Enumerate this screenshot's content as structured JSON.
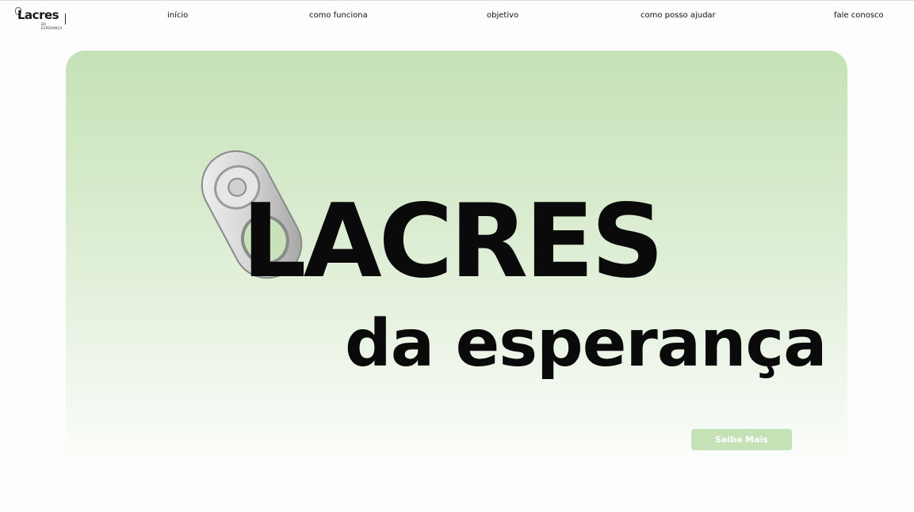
{
  "brand": {
    "logo_text": "Lacres",
    "logo_subtext": "da esperança"
  },
  "nav": {
    "items": [
      {
        "label": "início"
      },
      {
        "label": "como funciona"
      },
      {
        "label": "objetivo"
      },
      {
        "label": "como posso ajudar"
      },
      {
        "label": "fale conosco"
      }
    ]
  },
  "hero": {
    "title": "LACRES",
    "subtitle": "da esperança",
    "cta_label": "Saiba Mais"
  },
  "colors": {
    "accent_green": "#c5e2b6",
    "text_dark": "#0a0a0a",
    "background": "#fdfdfd"
  },
  "icons": {
    "hero_image": "soda-can-pull-tab",
    "logo_mark": "pull-tab-icon"
  }
}
